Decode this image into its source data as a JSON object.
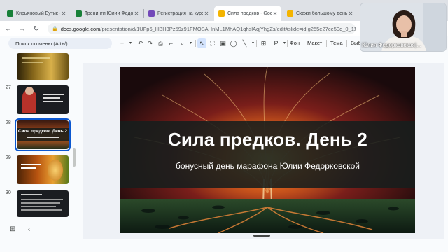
{
  "browser": {
    "tabs": [
      {
        "label": "Кирьяновый Бутик - Goo",
        "favicon_color": "#188038"
      },
      {
        "label": "Тренинги Юлии Федорк",
        "favicon_color": "#188038"
      },
      {
        "label": "Регистрация на курс «В",
        "favicon_color": "#7248b9"
      },
      {
        "label": "Сила предков - Google",
        "favicon_color": "#f4b400"
      },
      {
        "label": "Скажи большому деньг",
        "favicon_color": "#f4b400"
      }
    ],
    "url_host": "docs.google.com",
    "url_path": "/presentation/d/1UFp6_HBH3Pz59z91FMOSAHnML1MhAQ1qhslAqjYhgZs/edit#slide=id.g255e27ce50d_0_11"
  },
  "toolbar": {
    "menu_search_placeholder": "Поиск по меню (Alt+/)",
    "background_label": "Фон",
    "layout_label": "Макет",
    "theme_label": "Тема",
    "transition_label": "Выб"
  },
  "filmstrip": {
    "slides": [
      {
        "number": "",
        "caption": "",
        "selected": false
      },
      {
        "number": "27",
        "caption": "",
        "selected": false
      },
      {
        "number": "28",
        "caption": "Сила предков. День 2",
        "selected": true
      },
      {
        "number": "29",
        "caption": "",
        "selected": false
      },
      {
        "number": "30",
        "caption": "",
        "selected": false
      }
    ]
  },
  "slide": {
    "title": "Сила предков. День 2",
    "subtitle": "бонусный день марафона Юлии Федорковской"
  },
  "webcam": {
    "name": "Юлия Федорковская|..."
  },
  "icons": [
    "plus-icon",
    "undo-icon",
    "redo-icon",
    "print-icon",
    "paint-format-icon",
    "zoom-icon",
    "cursor-icon",
    "select-frame-icon",
    "image-icon",
    "shape-icon",
    "line-icon",
    "comment-icon",
    "paint-icon",
    "grid-view-icon",
    "collapse-icon",
    "back-icon",
    "forward-icon",
    "reload-icon",
    "lock-icon"
  ]
}
